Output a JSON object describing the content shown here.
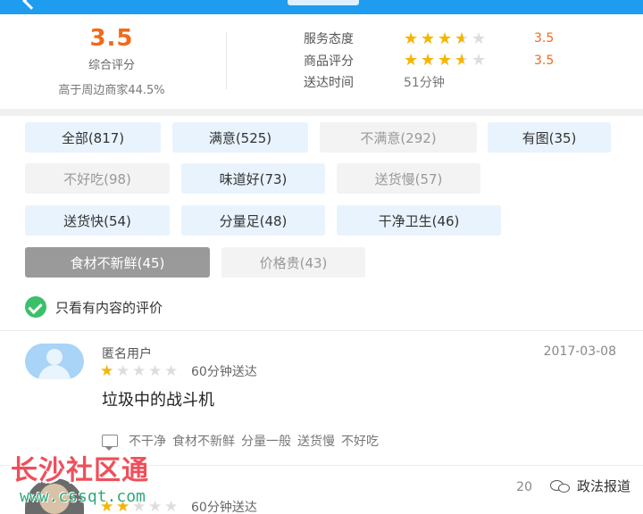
{
  "summary": {
    "score": "3.5",
    "score_label": "综合评分",
    "compare": "高于周边商家44.5%",
    "rows": [
      {
        "label": "服务态度",
        "rating": 3.5,
        "value": "3.5"
      },
      {
        "label": "商品评分",
        "rating": 3.5,
        "value": "3.5"
      },
      {
        "label": "送达时间",
        "text": "51分钟"
      }
    ]
  },
  "tags": [
    {
      "label": "全部(817)",
      "kind": "pos"
    },
    {
      "label": "满意(525)",
      "kind": "pos"
    },
    {
      "label": "不满意(292)",
      "kind": "neg"
    },
    {
      "label": "有图(35)",
      "kind": "pos"
    },
    {
      "label": "不好吃(98)",
      "kind": "neg"
    },
    {
      "label": "味道好(73)",
      "kind": "pos"
    },
    {
      "label": "送货慢(57)",
      "kind": "neg"
    },
    {
      "label": "送货快(54)",
      "kind": "pos"
    },
    {
      "label": "分量足(48)",
      "kind": "pos"
    },
    {
      "label": "干净卫生(46)",
      "kind": "pos"
    },
    {
      "label": "食材不新鲜(45)",
      "kind": "sel"
    },
    {
      "label": "价格贵(43)",
      "kind": "neg"
    }
  ],
  "filter": {
    "label": "只看有内容的评价",
    "checked": true
  },
  "reviews": [
    {
      "user": "匿名用户",
      "date": "2017-03-08",
      "rating": 1,
      "delivery": "60分钟送达",
      "content": "垃圾中的战斗机",
      "tags": [
        "不干净",
        "食材不新鲜",
        "分量一般",
        "送货慢",
        "不好吃"
      ]
    },
    {
      "user": "",
      "date": "20",
      "rating": 2,
      "delivery": "60分钟送达"
    }
  ],
  "watermark": {
    "site": "长沙社区通",
    "url": "www.cssqt.com",
    "account": "政法报道"
  },
  "colors": {
    "accent": "#1e9cf0",
    "score": "#f26a1b",
    "star": "#f6b500",
    "check": "#3cbf6a"
  }
}
